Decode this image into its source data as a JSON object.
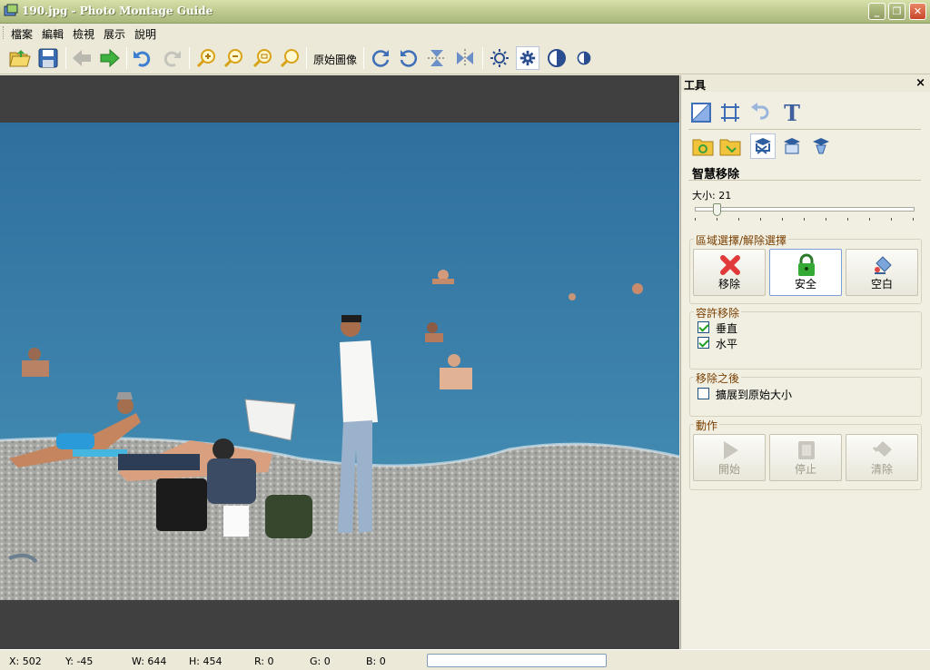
{
  "window": {
    "title": "190.jpg - Photo Montage Guide",
    "minimize": "_",
    "maximize": "❐",
    "close": "✕"
  },
  "menu": [
    "檔案",
    "編輯",
    "檢視",
    "展示",
    "說明"
  ],
  "toolbar": {
    "original_label": "原始圖像"
  },
  "panel": {
    "title": "工具",
    "close": "×",
    "section_title": "智慧移除",
    "size_label": "大小: 21",
    "size_value": 21,
    "region": {
      "label": "區域選擇/解除選擇",
      "buttons": [
        "移除",
        "安全",
        "空白"
      ],
      "selected": "安全"
    },
    "tolerance": {
      "label": "容許移除",
      "items": [
        {
          "label": "垂直",
          "checked": true
        },
        {
          "label": "水平",
          "checked": true
        }
      ]
    },
    "after": {
      "label": "移除之後",
      "items": [
        {
          "label": "擴展到原始大小",
          "checked": false
        }
      ]
    },
    "action": {
      "label": "動作",
      "buttons": [
        "開始",
        "停止",
        "清除"
      ]
    }
  },
  "status": {
    "x": "X: 502",
    "y": "Y: -45",
    "w": "W: 644",
    "h": "H: 454",
    "r": "R: 0",
    "g": "G: 0",
    "b": "B: 0"
  },
  "colors": {
    "accent": "#0a246a",
    "group_label": "#7a3f00",
    "sea": "#3d7ba4",
    "beach": "#a8a8a4"
  }
}
